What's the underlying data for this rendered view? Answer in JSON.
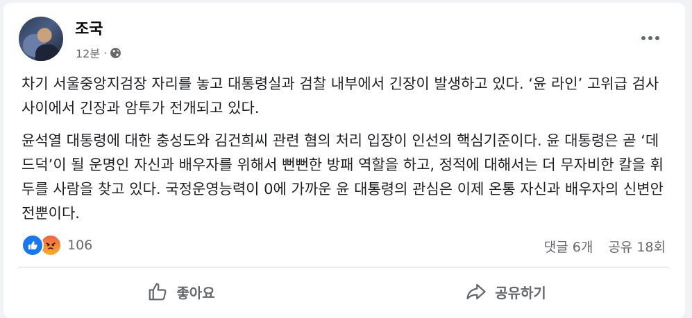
{
  "post": {
    "author": "조국",
    "time": "12분",
    "separator": "·",
    "privacy_icon": "globe-icon",
    "paragraphs": [
      "차기 서울중앙지검장 자리를 놓고 대통령실과 검찰 내부에서 긴장이 발생하고 있다. ‘윤 라인’ 고위급 검사 사이에서 긴장과 암투가 전개되고 있다.",
      "윤석열 대통령에 대한 충성도와 김건희씨 관련 혐의 처리 입장이 인선의 핵심기준이다. 윤 대통령은 곧 ‘데드덕’이 될 운명인 자신과 배우자를 위해서 뻔뻔한 방패 역할을 하고, 정적에 대해서는 더 무자비한 칼을 휘두를 사람을 찾고 있다. 국정운영능력이 0에 가까운 윤 대통령의 관심은 이제 온통 자신과 배우자의 신변안전뿐이다."
    ]
  },
  "reactions": {
    "count": "106",
    "icons": [
      "like-icon",
      "angry-icon"
    ]
  },
  "stats": {
    "comments": "댓글 6개",
    "shares": "공유 18회"
  },
  "actions": {
    "like_label": "좋아요",
    "share_label": "공유하기"
  },
  "colors": {
    "like_blue": "#1877f2",
    "text_secondary": "#65676b",
    "background": "#f0f2f5"
  }
}
